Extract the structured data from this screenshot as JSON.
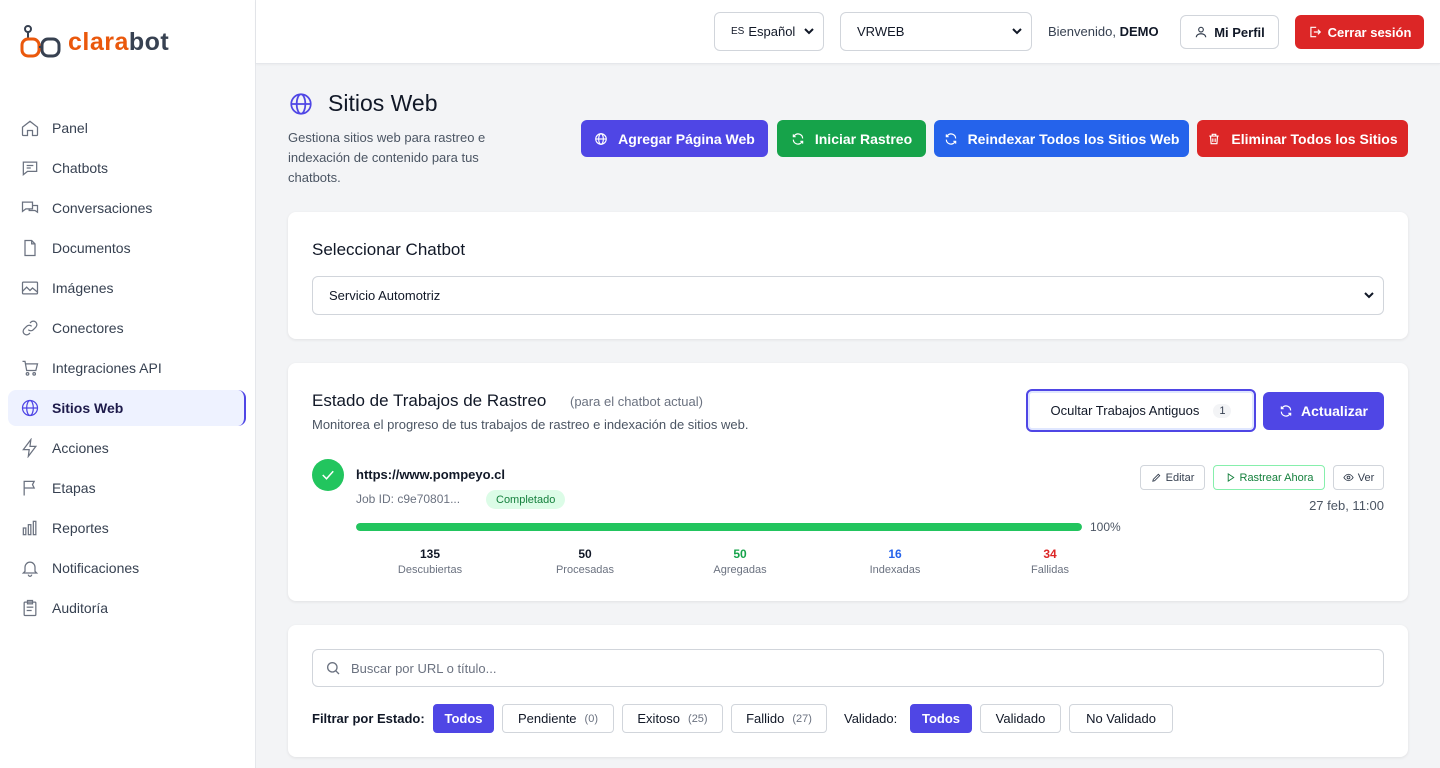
{
  "app": {
    "logo_left": "clara",
    "logo_right": "bot"
  },
  "sidebar": {
    "items": [
      {
        "label": "Panel",
        "icon": "home-icon"
      },
      {
        "label": "Chatbots",
        "icon": "chat-bubble-icon"
      },
      {
        "label": "Conversaciones",
        "icon": "conversations-icon"
      },
      {
        "label": "Documentos",
        "icon": "document-icon"
      },
      {
        "label": "Imágenes",
        "icon": "image-icon"
      },
      {
        "label": "Conectores",
        "icon": "link-icon"
      },
      {
        "label": "Integraciones API",
        "icon": "cart-icon"
      },
      {
        "label": "Sitios Web",
        "icon": "globe-icon",
        "active": true
      },
      {
        "label": "Acciones",
        "icon": "bolt-icon"
      },
      {
        "label": "Etapas",
        "icon": "flag-icon"
      },
      {
        "label": "Reportes",
        "icon": "bar-chart-icon"
      },
      {
        "label": "Notificaciones",
        "icon": "bell-icon"
      },
      {
        "label": "Auditoría",
        "icon": "clipboard-icon"
      }
    ]
  },
  "header": {
    "language": "Español",
    "language_flag": "ES",
    "workspace": "VRWEB",
    "welcome_prefix": "Bienvenido,",
    "user": "DEMO",
    "profile_label": "Mi Perfil",
    "logout_label": "Cerrar sesión"
  },
  "page": {
    "title": "Sitios Web",
    "subtitle": "Gestiona sitios web para rastreo e indexación de contenido para tus chatbots.",
    "actions": [
      {
        "label": "Agregar Página Web",
        "color": "#4f46e5"
      },
      {
        "label": "Iniciar Rastreo",
        "color": "#16a34a"
      },
      {
        "label": "Reindexar Todos los Sitios Web",
        "color": "#2563eb"
      },
      {
        "label": "Eliminar Todos los Sitios",
        "color": "#dc2626"
      }
    ]
  },
  "chatbot_select": {
    "title": "Seleccionar Chatbot",
    "value": "Servicio Automotriz"
  },
  "jobs": {
    "title": "Estado de Trabajos de Rastreo",
    "tag": "(para el chatbot actual)",
    "subtitle": "Monitorea el progreso de tus trabajos de rastreo e indexación de sitios web.",
    "hide_label": "Ocultar Trabajos Antiguos",
    "hide_count": "1",
    "refresh_label": "Actualizar",
    "job": {
      "url": "https://www.pompeyo.cl",
      "id": "Job ID: c9e70801...",
      "status": "Completado",
      "edit_label": "Editar",
      "crawl_label": "Rastrear Ahora",
      "view_label": "Ver",
      "date": "27 feb, 11:00",
      "progress": 100,
      "progress_text": "100%",
      "stats": [
        {
          "value": "135",
          "label": "Descubiertas",
          "color": "#111827"
        },
        {
          "value": "50",
          "label": "Procesadas",
          "color": "#111827"
        },
        {
          "value": "50",
          "label": "Agregadas",
          "color": "#16a34a"
        },
        {
          "value": "16",
          "label": "Indexadas",
          "color": "#2563eb"
        },
        {
          "value": "34",
          "label": "Fallidas",
          "color": "#dc2626"
        }
      ]
    }
  },
  "filters": {
    "search_placeholder": "Buscar por URL o título...",
    "status_label": "Filtrar por Estado:",
    "status_chips": [
      {
        "label": "Todos",
        "count": "",
        "active": true
      },
      {
        "label": "Pendiente",
        "count": "(0)"
      },
      {
        "label": "Exitoso",
        "count": "(25)"
      },
      {
        "label": "Fallido",
        "count": "(27)"
      }
    ],
    "validated_label": "Validado:",
    "validated_chips": [
      {
        "label": "Todos",
        "active": true
      },
      {
        "label": "Validado"
      },
      {
        "label": "No Validado"
      }
    ]
  }
}
